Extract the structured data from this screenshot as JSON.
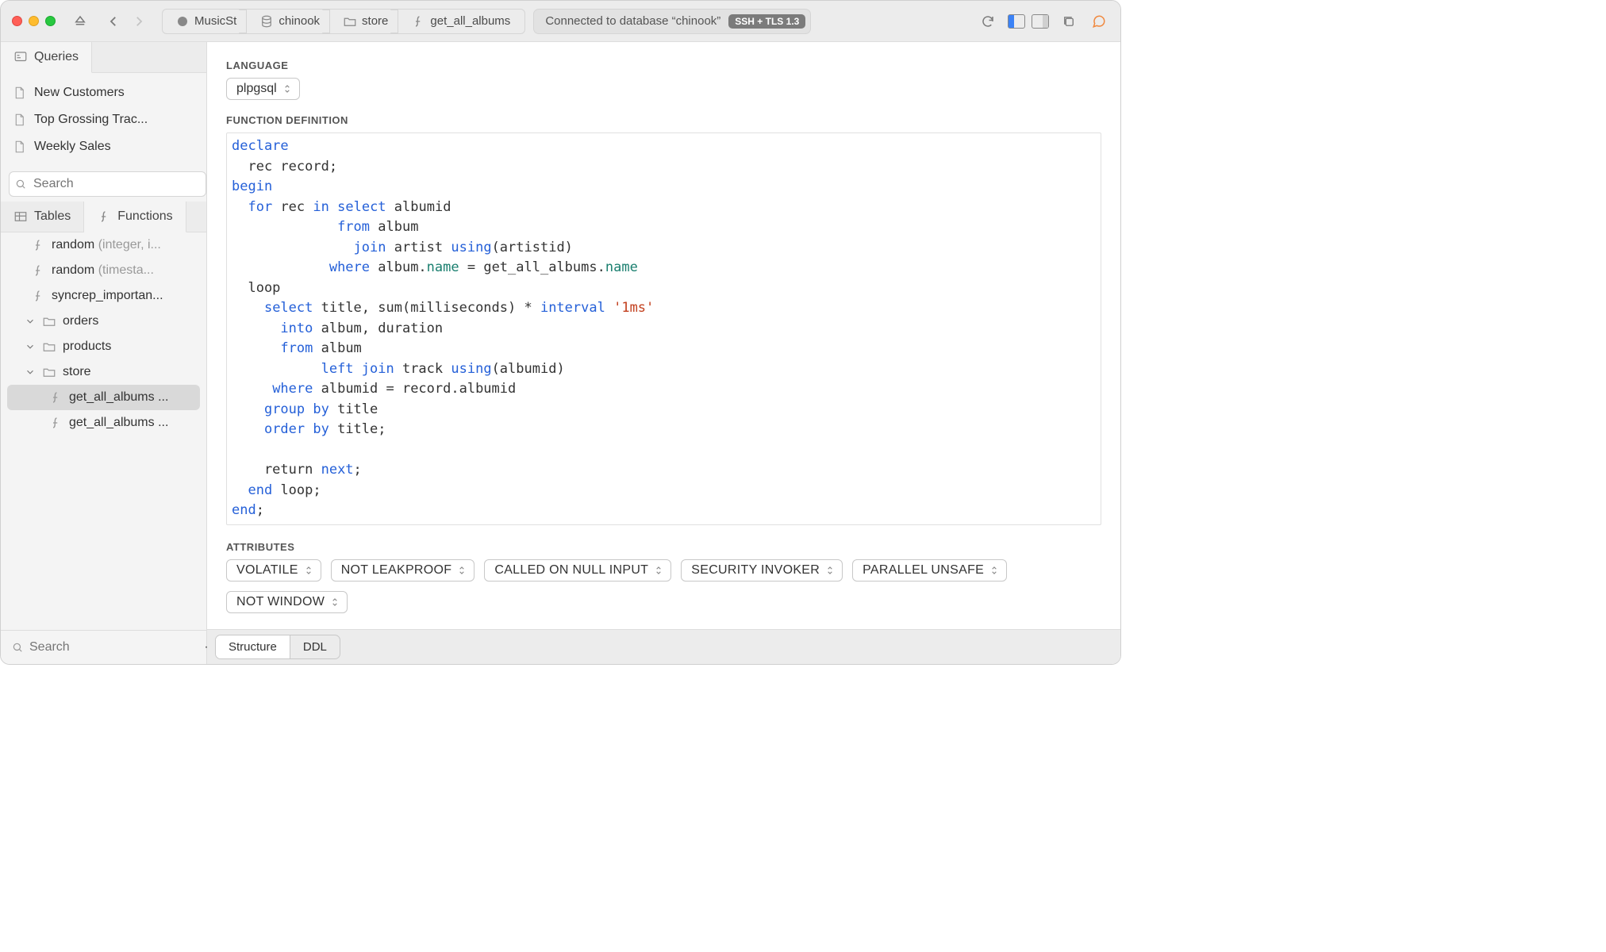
{
  "toolbar": {
    "breadcrumb": [
      {
        "icon": "elephant",
        "label": "MusicSt"
      },
      {
        "icon": "database",
        "label": "chinook"
      },
      {
        "icon": "folder",
        "label": "store"
      },
      {
        "icon": "function",
        "label": "get_all_albums"
      }
    ],
    "status_text": "Connected to database “chinook”",
    "status_tag": "SSH + TLS 1.3"
  },
  "sidebar": {
    "top_tab": "Queries",
    "queries": [
      "New Customers",
      "Top Grossing Trac...",
      "Weekly Sales"
    ],
    "search_placeholder": "Search",
    "mid_tabs": {
      "tables": "Tables",
      "functions": "Functions"
    },
    "tree": [
      {
        "depth": 1,
        "icon": "function",
        "label": "random ",
        "suffix": "(integer, i...",
        "selected": false
      },
      {
        "depth": 1,
        "icon": "function",
        "label": "random ",
        "suffix": "(timesta...",
        "selected": false
      },
      {
        "depth": 1,
        "icon": "function",
        "label": "syncrep_importan...",
        "selected": false
      },
      {
        "depth": 2,
        "icon": "folder",
        "label": "orders",
        "disclosure": true,
        "selected": false
      },
      {
        "depth": 2,
        "icon": "folder",
        "label": "products",
        "disclosure": true,
        "selected": false
      },
      {
        "depth": 2,
        "icon": "folder",
        "label": "store",
        "disclosure": true,
        "open": true,
        "selected": false
      },
      {
        "depth": 3,
        "icon": "function",
        "label": "get_all_albums ...",
        "selected": true
      },
      {
        "depth": 3,
        "icon": "function",
        "label": "get_all_albums ...",
        "selected": false
      }
    ],
    "footer_search_placeholder": "Search"
  },
  "editor": {
    "language_label": "LANGUAGE",
    "language_value": "plpgsql",
    "definition_label": "FUNCTION DEFINITION",
    "attributes_label": "ATTRIBUTES",
    "attributes": [
      "VOLATILE",
      "NOT LEAKPROOF",
      "CALLED ON NULL INPUT",
      "SECURITY INVOKER",
      "PARALLEL UNSAFE",
      "NOT WINDOW"
    ],
    "footer_tabs": {
      "structure": "Structure",
      "ddl": "DDL"
    }
  }
}
